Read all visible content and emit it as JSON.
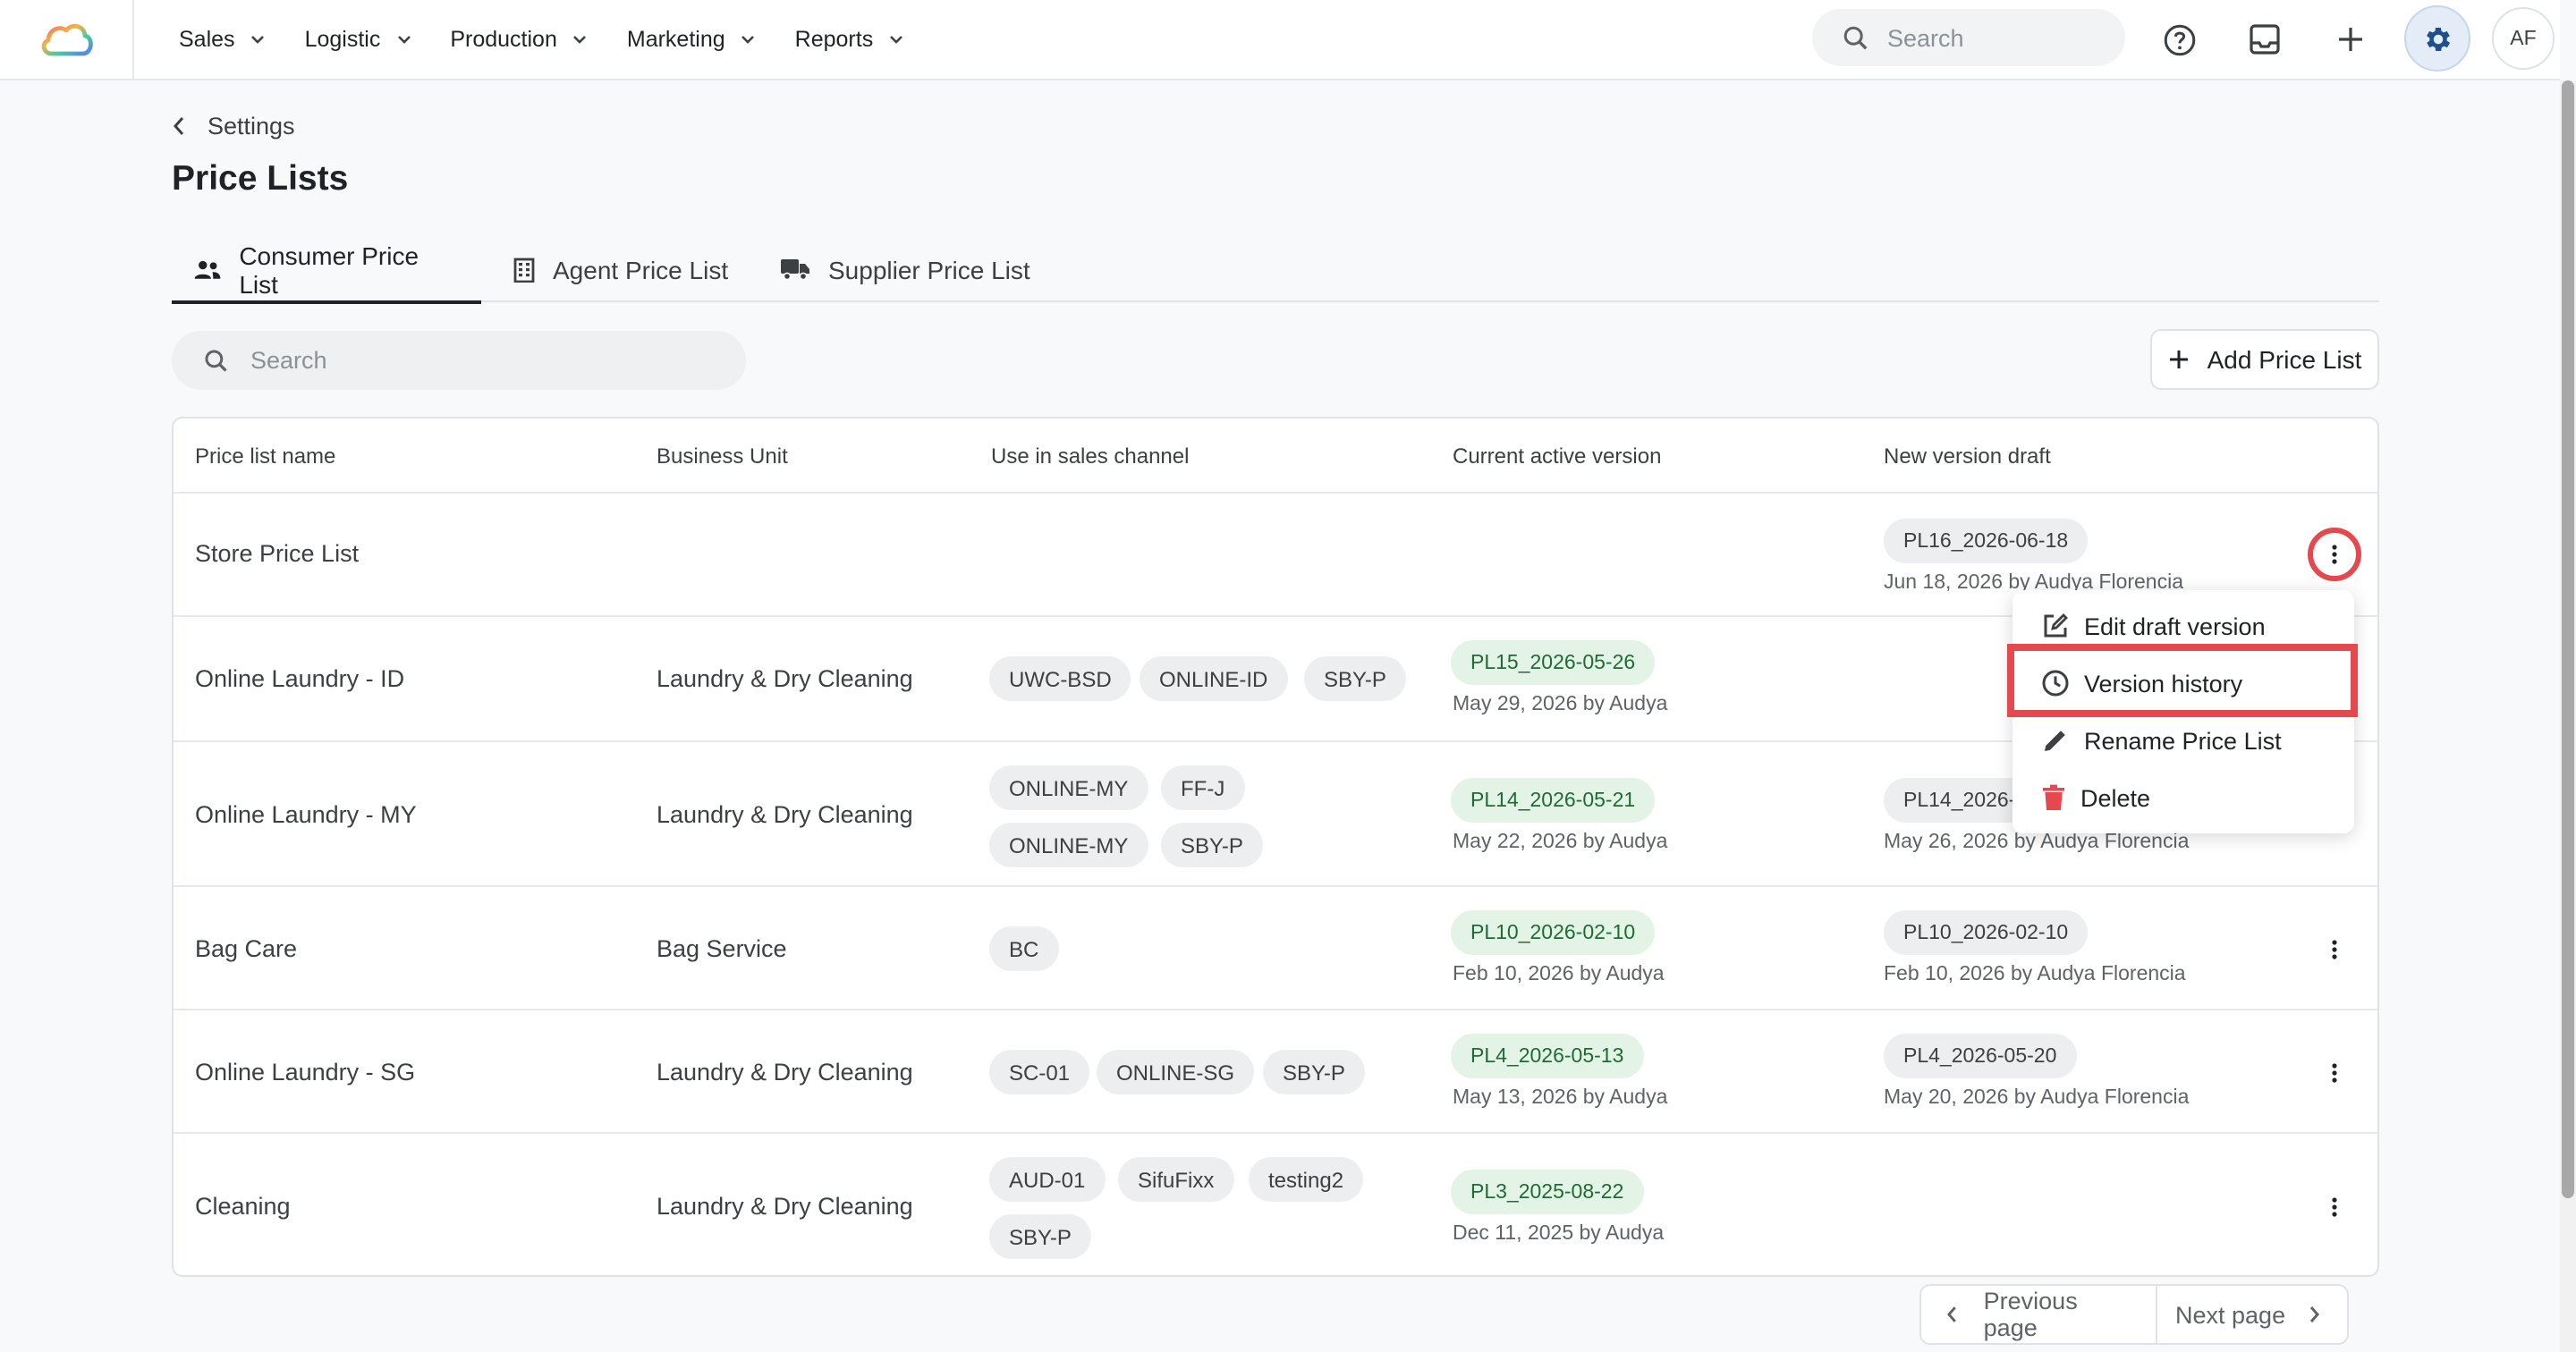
{
  "nav": {
    "items": [
      {
        "label": "Sales"
      },
      {
        "label": "Logistic"
      },
      {
        "label": "Production"
      },
      {
        "label": "Marketing"
      },
      {
        "label": "Reports"
      }
    ],
    "search_placeholder": "Search",
    "avatar_initials": "AF"
  },
  "breadcrumb": {
    "back_label": "Settings"
  },
  "page": {
    "title": "Price Lists"
  },
  "tabs": [
    {
      "label": "Consumer Price List",
      "active": true,
      "icon": "users-icon"
    },
    {
      "label": "Agent Price List",
      "active": false,
      "icon": "building-icon"
    },
    {
      "label": "Supplier Price List",
      "active": false,
      "icon": "truck-icon"
    }
  ],
  "toolbar": {
    "search_placeholder": "Search",
    "add_label": "Add Price List"
  },
  "table": {
    "columns": [
      "Price list name",
      "Business Unit",
      "Use in sales channel",
      "Current active version",
      "New version draft"
    ],
    "rows": [
      {
        "name": "Store Price List",
        "business_unit": "",
        "channels": [],
        "active_version": null,
        "draft_version": {
          "code": "PL16_2026-06-18",
          "meta": "Jun 18, 2026 by Audya Florencia"
        }
      },
      {
        "name": "Online Laundry - ID",
        "business_unit": "Laundry & Dry Cleaning",
        "channels": [
          "UWC-BSD",
          "ONLINE-ID",
          "SBY-P"
        ],
        "active_version": {
          "code": "PL15_2026-05-26",
          "meta": "May 29, 2026 by Audya"
        },
        "draft_version": null
      },
      {
        "name": "Online Laundry - MY",
        "business_unit": "Laundry & Dry Cleaning",
        "channels": [
          "ONLINE-MY",
          "FF-J",
          "ONLINE-MY",
          "SBY-P"
        ],
        "active_version": {
          "code": "PL14_2026-05-21",
          "meta": "May 22, 2026 by Audya"
        },
        "draft_version": {
          "code": "PL14_2026-",
          "meta": "May 26, 2026 by Audya Florencia"
        }
      },
      {
        "name": "Bag Care",
        "business_unit": "Bag Service",
        "channels": [
          "BC"
        ],
        "active_version": {
          "code": "PL10_2026-02-10",
          "meta": "Feb 10, 2026 by Audya"
        },
        "draft_version": {
          "code": "PL10_2026-02-10",
          "meta": "Feb 10, 2026 by Audya Florencia"
        }
      },
      {
        "name": "Online Laundry - SG",
        "business_unit": "Laundry & Dry Cleaning",
        "channels": [
          "SC-01",
          "ONLINE-SG",
          "SBY-P"
        ],
        "active_version": {
          "code": "PL4_2026-05-13",
          "meta": "May 13, 2026 by Audya"
        },
        "draft_version": {
          "code": "PL4_2026-05-20",
          "meta": "May 20, 2026 by Audya Florencia"
        }
      },
      {
        "name": "Cleaning",
        "business_unit": "Laundry & Dry Cleaning",
        "channels": [
          "AUD-01",
          "SifuFixx",
          "testing2",
          "SBY-P"
        ],
        "active_version": {
          "code": "PL3_2025-08-22",
          "meta": "Dec 11, 2025 by Audya"
        },
        "draft_version": null
      }
    ]
  },
  "row_menu": {
    "items": [
      {
        "label": "Edit draft version",
        "icon": "edit-icon"
      },
      {
        "label": "Version history",
        "icon": "clock-icon",
        "highlighted": true
      },
      {
        "label": "Rename Price List",
        "icon": "pencil-icon"
      },
      {
        "label": "Delete",
        "icon": "trash-icon",
        "color": "#e5484d"
      }
    ]
  },
  "pagination": {
    "prev_label": "Previous page",
    "next_label": "Next page"
  }
}
